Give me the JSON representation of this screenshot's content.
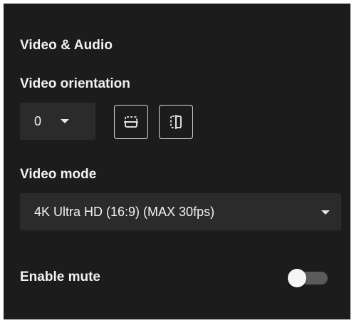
{
  "section": {
    "title": "Video & Audio"
  },
  "orientation": {
    "label": "Video orientation",
    "selected": "0",
    "buttons": {
      "flip_horizontal": "flip-horizontal-icon",
      "flip_vertical": "flip-vertical-icon"
    }
  },
  "mode": {
    "label": "Video mode",
    "selected": "4K Ultra HD (16:9) (MAX 30fps)"
  },
  "mute": {
    "label": "Enable mute",
    "enabled": false
  },
  "colors": {
    "panel_bg": "#1c1c1c",
    "control_bg": "#2b2b2b",
    "text": "#f2f2f2",
    "toggle_track": "#5a5a5a"
  }
}
